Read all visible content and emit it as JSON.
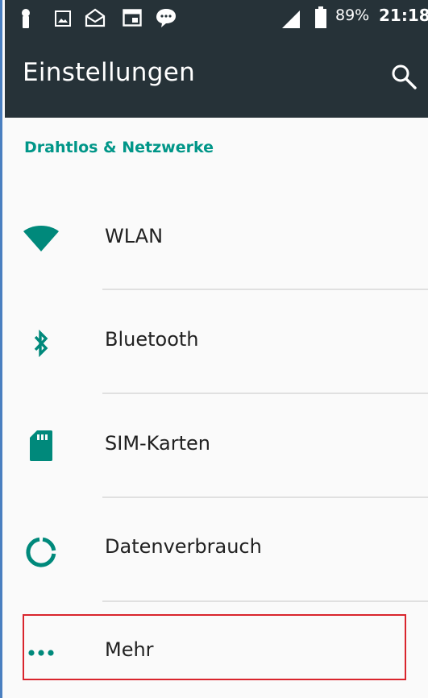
{
  "status_bar": {
    "battery": "89%",
    "time": "21:18",
    "icons": [
      "person-icon",
      "image-icon",
      "mail-icon",
      "calendar-icon",
      "chat-icon",
      "signal-icon",
      "battery-icon"
    ]
  },
  "app_bar": {
    "title": "Einstellungen",
    "search_icon": "search-icon",
    "background": "#263238"
  },
  "section": {
    "title": "Drahtlos & Netzwerke",
    "accent": "#009688"
  },
  "items": [
    {
      "label": "WLAN",
      "icon": "wifi-icon"
    },
    {
      "label": "Bluetooth",
      "icon": "bluetooth-icon"
    },
    {
      "label": "SIM-Karten",
      "icon": "sim-card-icon"
    },
    {
      "label": "Datenverbrauch",
      "icon": "data-usage-icon"
    },
    {
      "label": "Mehr",
      "icon": "more-icon",
      "highlighted": true
    }
  ]
}
